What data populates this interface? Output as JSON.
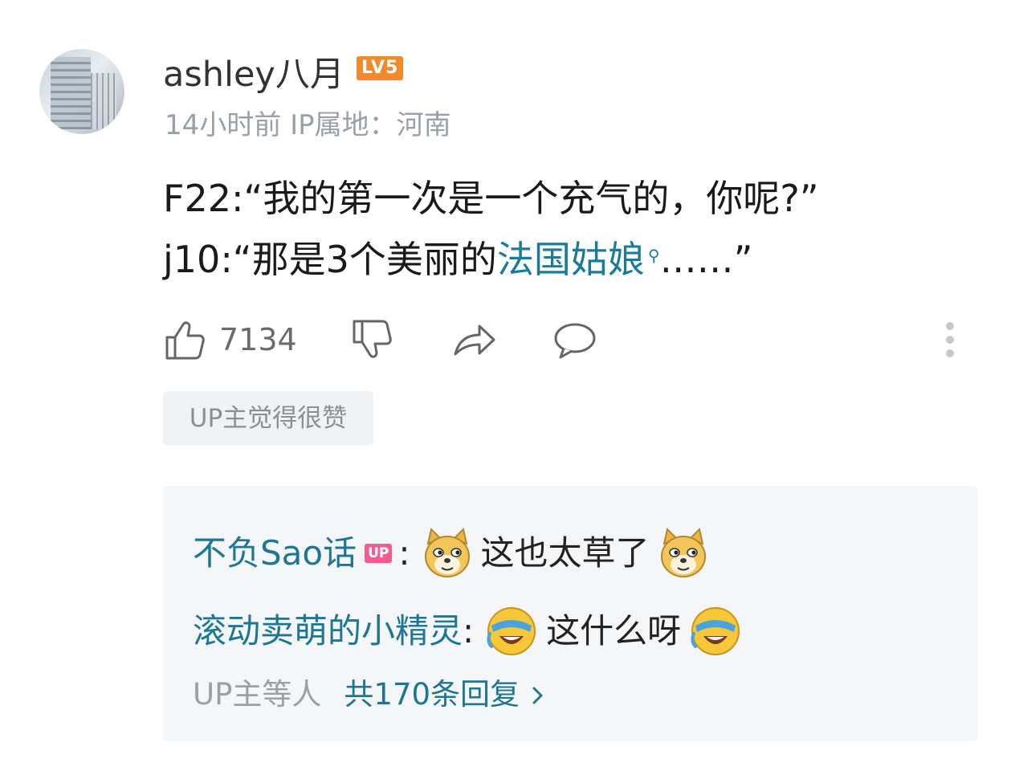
{
  "comment": {
    "username": "ashley八月",
    "level": "LV5",
    "meta": "14小时前 IP属地：河南",
    "line1": "F22:“我的第一次是一个充气的，你呢?”",
    "line2_prefix": "j10:“那是3个美丽的",
    "line2_link": "法国姑娘",
    "line2_suffix": "……”"
  },
  "actions": {
    "like_count": "7134"
  },
  "tag": "UP主觉得很赞",
  "replies": {
    "items": [
      {
        "name": "不负Sao话",
        "badge": "UP",
        "colon": ":",
        "text": "这也太草了",
        "emoji": "doge-emoji"
      },
      {
        "name": "滚动卖萌的小精灵",
        "colon": ":",
        "text": "这什么呀",
        "emoji": "laughing-crying-emoji"
      }
    ],
    "more_who": "UP主等人",
    "more_total": "共170条回复"
  },
  "colors": {
    "link": "#1b7c9a",
    "level_badge": "#f08a2b",
    "up_badge": "#f25d8e",
    "reply_bg": "#f4f6f8"
  }
}
